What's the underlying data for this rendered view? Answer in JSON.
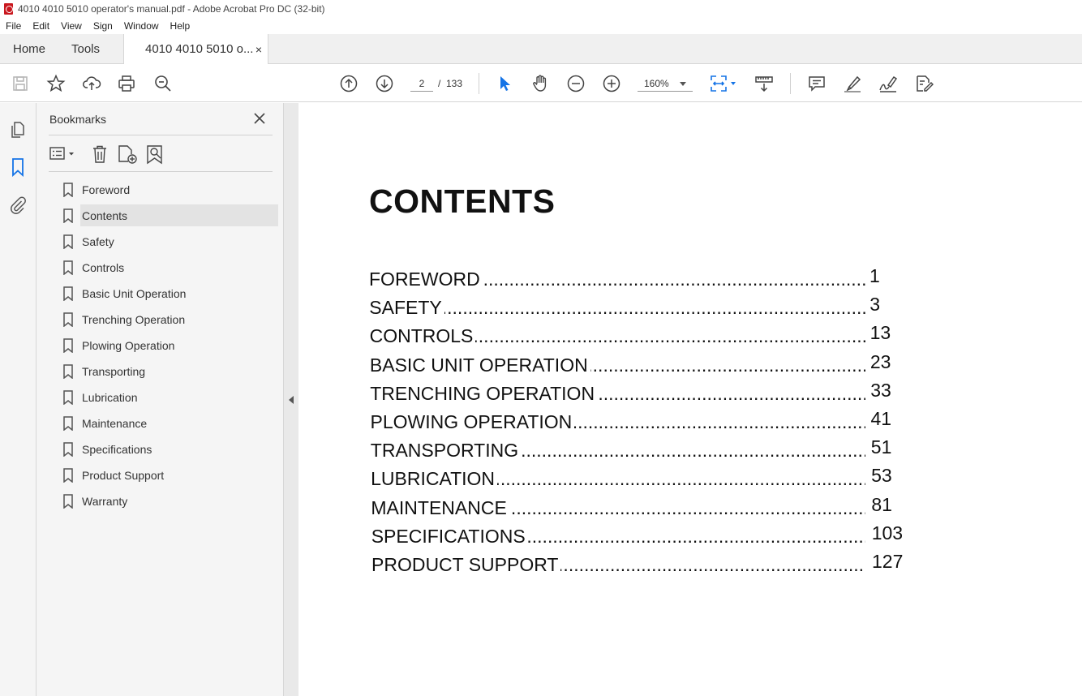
{
  "window": {
    "title": "4010 4010 5010 operator's manual.pdf - Adobe Acrobat Pro DC (32-bit)"
  },
  "menu": [
    "File",
    "Edit",
    "View",
    "Sign",
    "Window",
    "Help"
  ],
  "tabs": {
    "home": "Home",
    "tools": "Tools",
    "document": "4010 4010 5010 o...",
    "close": "×"
  },
  "navigation": {
    "current_page": "2",
    "separator": "/",
    "total_pages": "133",
    "zoom": "160%"
  },
  "icons": {
    "toolbar": [
      "save-icon",
      "star-icon",
      "upload-icon",
      "print-icon",
      "search-icon",
      "page-up-icon",
      "page-down-icon",
      "select-cursor-icon",
      "hand-icon",
      "zoom-out-icon",
      "zoom-in-icon",
      "fit-page-icon",
      "scroll-mode-icon",
      "comment-icon",
      "highlight-icon",
      "sign-icon",
      "edit-pdf-icon"
    ],
    "rail": [
      "page-thumbnails-icon",
      "bookmark-icon",
      "attachment-icon"
    ]
  },
  "colors": {
    "accent": "#1473e6",
    "selection": "#e3e3e3"
  },
  "bookmarks": {
    "title": "Bookmarks",
    "selected_index": 1,
    "items": [
      "Foreword",
      "Contents",
      "Safety",
      "Controls",
      "Basic Unit Operation",
      "Trenching Operation",
      "Plowing Operation",
      "Transporting",
      "Lubrication",
      "Maintenance",
      "Specifications",
      "Product Support",
      "Warranty"
    ]
  },
  "document": {
    "heading": "CONTENTS",
    "toc": [
      {
        "title": "FOREWORD",
        "page": "1"
      },
      {
        "title": "SAFETY",
        "page": "3"
      },
      {
        "title": "CONTROLS",
        "page": "13"
      },
      {
        "title": "BASIC UNIT OPERATION",
        "page": "23"
      },
      {
        "title": "TRENCHING OPERATION",
        "page": "33"
      },
      {
        "title": "PLOWING OPERATION",
        "page": "41"
      },
      {
        "title": "TRANSPORTING",
        "page": "51"
      },
      {
        "title": "LUBRICATION",
        "page": "53"
      },
      {
        "title": "MAINTENANCE",
        "page": "81"
      },
      {
        "title": "SPECIFICATIONS",
        "page": "103"
      },
      {
        "title": "PRODUCT SUPPORT",
        "page": "127"
      }
    ]
  }
}
